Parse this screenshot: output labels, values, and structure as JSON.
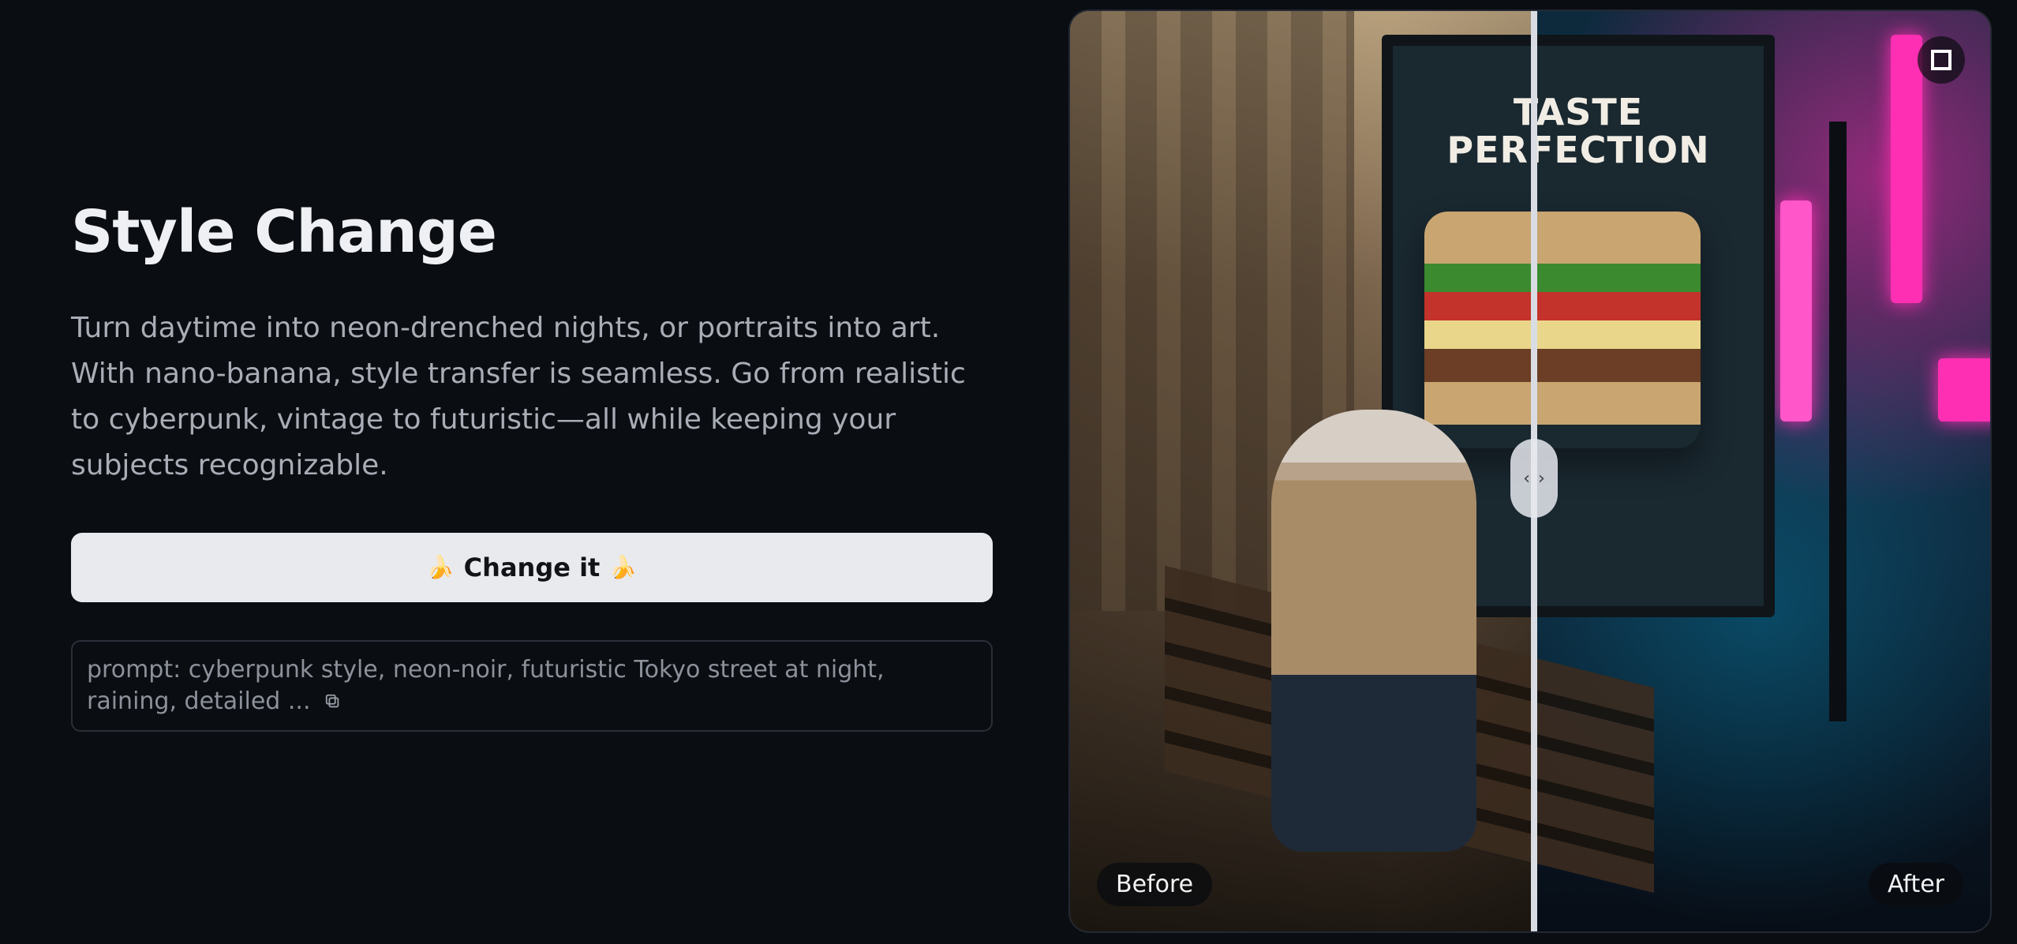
{
  "feature": {
    "title": "Style Change",
    "description": "Turn daytime into neon-drenched nights, or portraits into art. With nano-banana, style transfer is seamless. Go from realistic to cyberpunk, vintage to futuristic—all while keeping your subjects recognizable.",
    "cta_label": "Change it",
    "cta_icon": "banana-icon",
    "prompt_text": "prompt: cyberpunk style, neon-noir, futuristic Tokyo street at night, raining, detailed ...",
    "copy_icon": "copy-icon"
  },
  "compare": {
    "poster_title": "TASTE PERFECTION",
    "before_label": "Before",
    "after_label": "After",
    "fullscreen_icon": "fullscreen-icon",
    "slider_position": 0.504
  }
}
